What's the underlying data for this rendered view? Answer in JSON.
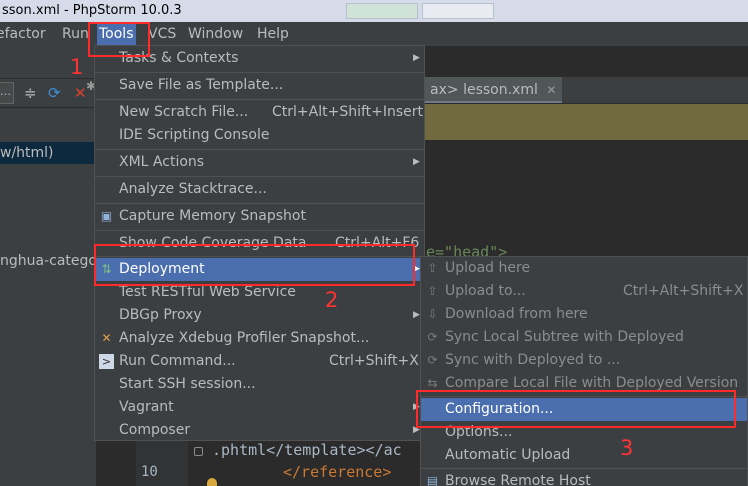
{
  "window": {
    "title": "sson.xml - PhpStorm 10.0.3"
  },
  "menubar": [
    {
      "label": "efactor"
    },
    {
      "label": "Run"
    },
    {
      "label": "Tools"
    },
    {
      "label": "VCS"
    },
    {
      "label": "Window"
    },
    {
      "label": "Help"
    }
  ],
  "left_panel": {
    "selected_row": "w/html)",
    "row2": "nghua-catego"
  },
  "editor": {
    "tab_prefix": "ax>",
    "tab_label": "lesson.xml",
    "code_line1": "e=\"head\">",
    "code_line_template": ".phtml</template></ac",
    "code_line_reference": "</reference>",
    "line_number": "10"
  },
  "tools_menu": {
    "items": [
      {
        "label": "Tasks & Contexts"
      },
      {
        "label": "Save File as Template..."
      },
      {
        "label": "New Scratch File...",
        "shortcut": "Ctrl+Alt+Shift+Insert"
      },
      {
        "label": "IDE Scripting Console"
      },
      {
        "label": "XML Actions"
      },
      {
        "label": "Analyze Stacktrace..."
      },
      {
        "label": "Capture Memory Snapshot"
      },
      {
        "label": "Show Code Coverage Data",
        "shortcut": "Ctrl+Alt+F6"
      },
      {
        "label": "Deployment"
      },
      {
        "label": "Test RESTful Web Service"
      },
      {
        "label": "DBGp Proxy"
      },
      {
        "label": "Analyze Xdebug Profiler Snapshot..."
      },
      {
        "label": "Run Command...",
        "shortcut": "Ctrl+Shift+X"
      },
      {
        "label": "Start SSH session..."
      },
      {
        "label": "Vagrant"
      },
      {
        "label": "Composer"
      }
    ]
  },
  "deployment_menu": {
    "items": [
      {
        "label": "Upload here"
      },
      {
        "label": "Upload to...",
        "shortcut": "Ctrl+Alt+Shift+X"
      },
      {
        "label": "Download from here"
      },
      {
        "label": "Sync Local Subtree with Deployed"
      },
      {
        "label": "Sync with Deployed to ..."
      },
      {
        "label": "Compare Local File with Deployed Version"
      },
      {
        "label": "Configuration..."
      },
      {
        "label": "Options..."
      },
      {
        "label": "Automatic Upload"
      },
      {
        "label": "Browse Remote Host"
      }
    ]
  },
  "annotations": {
    "step1": "1",
    "step2": "2",
    "step3": "3"
  },
  "colors": {
    "highlight": "#4b6eaf",
    "annotation": "#ff2a2a"
  }
}
